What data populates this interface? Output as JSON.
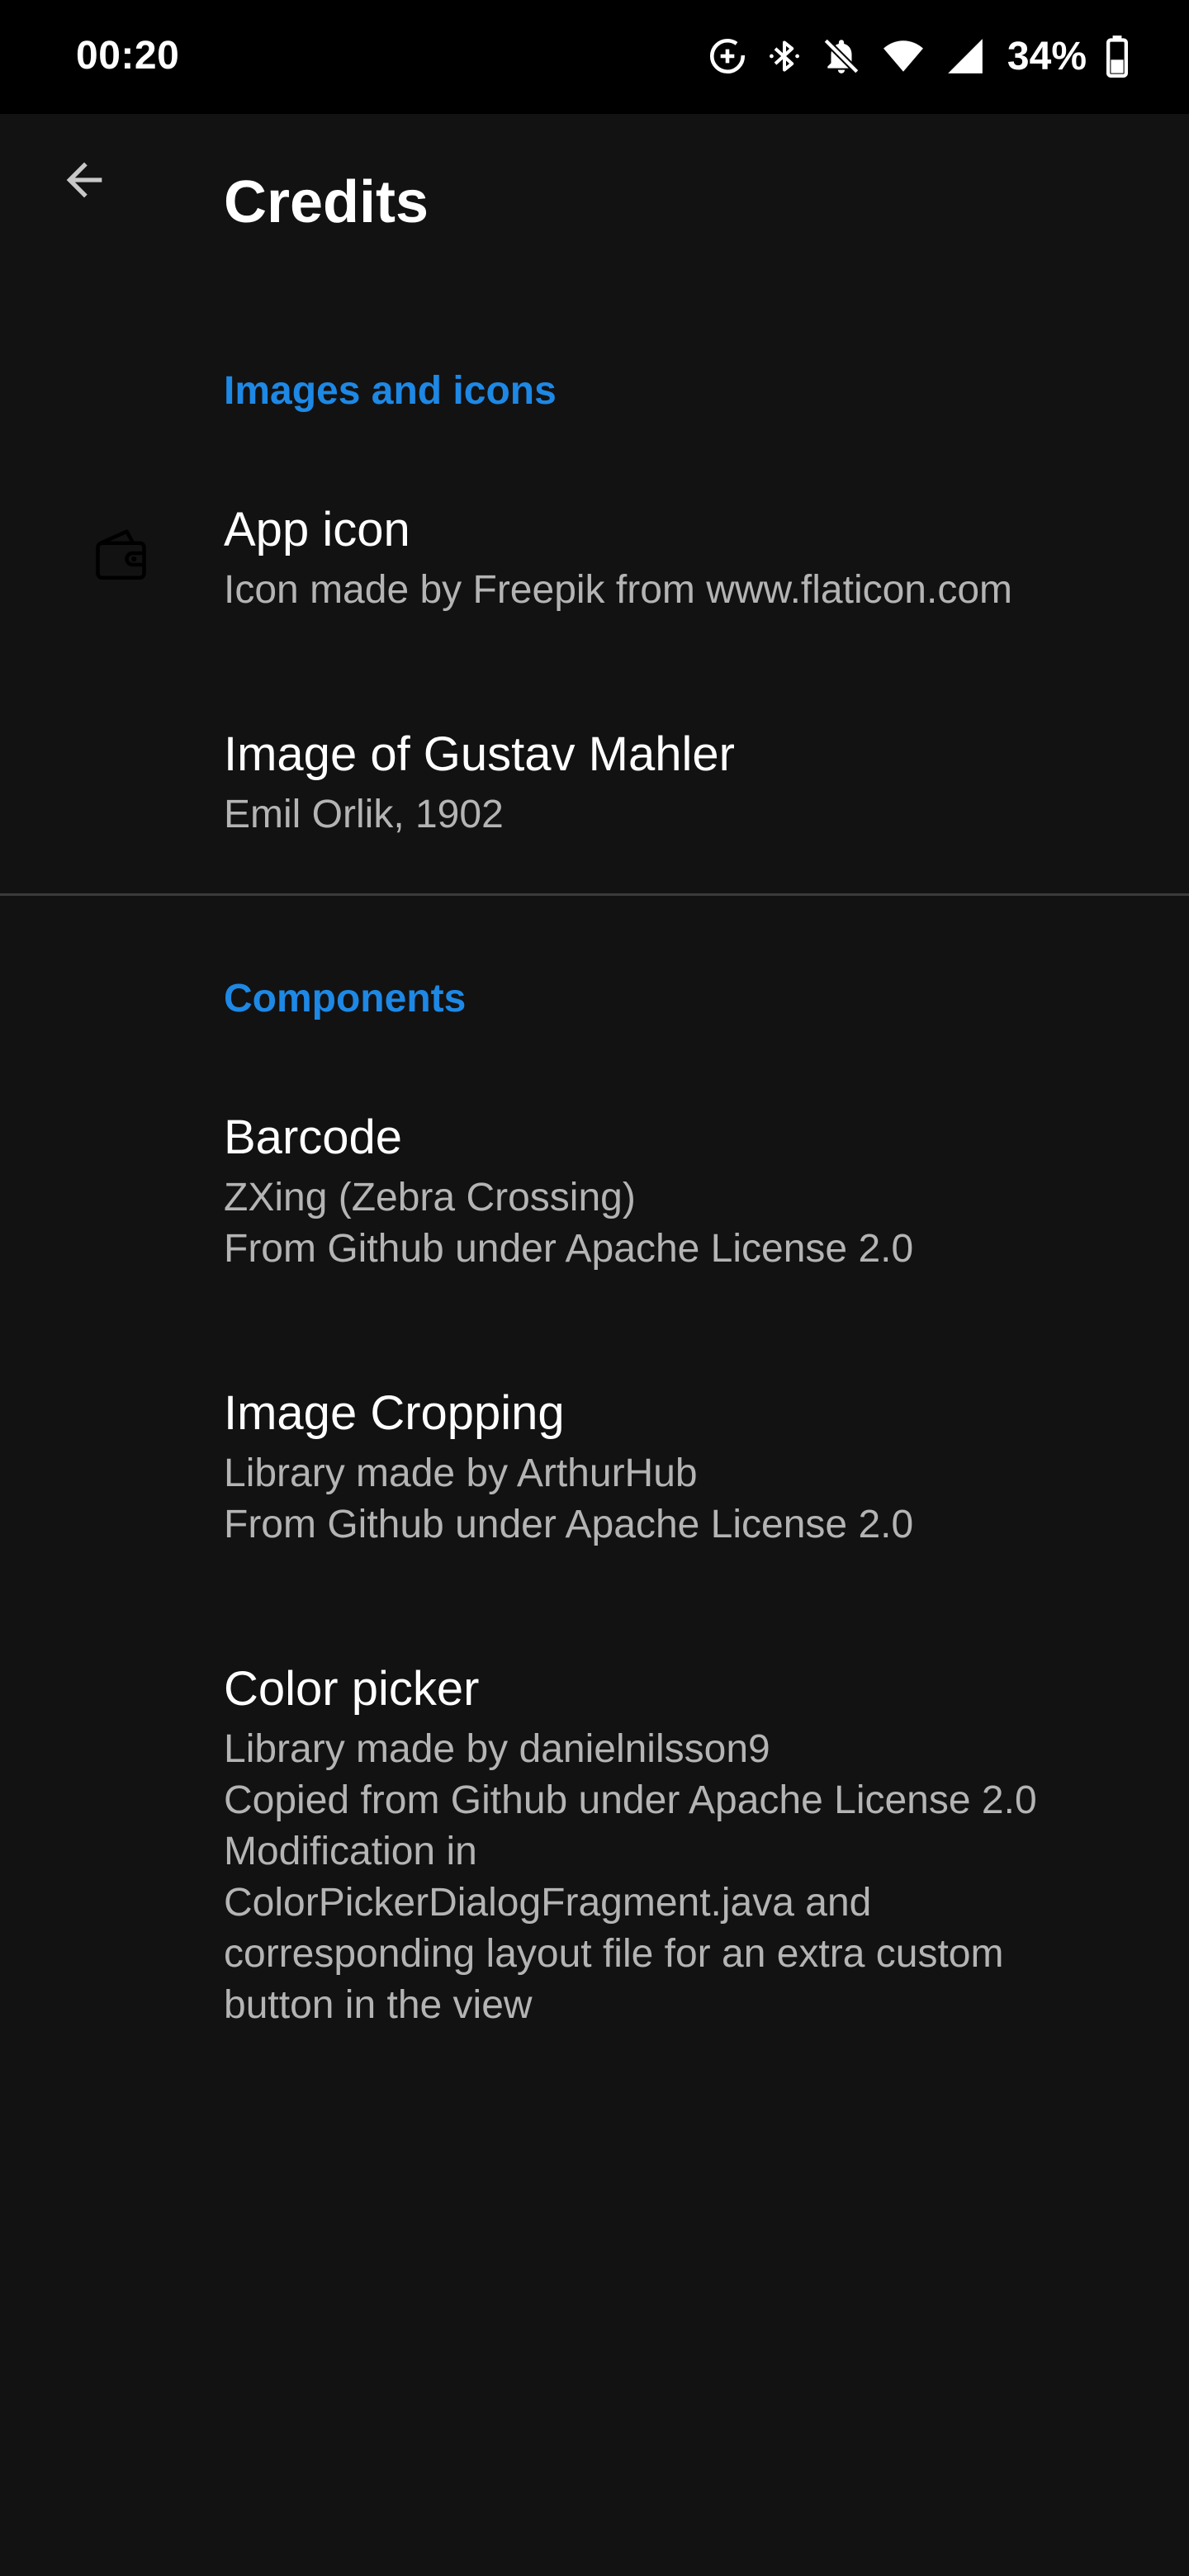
{
  "status_bar": {
    "time": "00:20",
    "battery_percent": "34%",
    "icons": [
      "data-saver-icon",
      "bluetooth-icon",
      "notifications-off-icon",
      "wifi-icon",
      "signal-icon",
      "battery-icon"
    ]
  },
  "app_bar": {
    "title": "Credits",
    "back_icon": "arrow-back-icon"
  },
  "sections": {
    "images": {
      "header": "Images and icons",
      "items": [
        {
          "title": "App icon",
          "summary": [
            "Icon made by Freepik from www.flaticon.com"
          ],
          "icon": "wallet-icon"
        },
        {
          "title": "Image of Gustav Mahler",
          "summary": [
            "Emil Orlik, 1902"
          ]
        }
      ]
    },
    "components": {
      "header": "Components",
      "items": [
        {
          "title": "Barcode",
          "summary": [
            "ZXing (Zebra Crossing)",
            "From Github under Apache License 2.0"
          ]
        },
        {
          "title": "Image Cropping",
          "summary": [
            "Library made by ArthurHub",
            "From Github under Apache License 2.0"
          ]
        },
        {
          "title": "Color picker",
          "summary": [
            "Library made by danielnilsson9",
            "Copied from Github under Apache License 2.0",
            "Modification in",
            "ColorPickerDialogFragment.java and",
            "corresponding layout file for an extra custom",
            "button in the view"
          ]
        }
      ]
    }
  },
  "colors": {
    "background": "#121212",
    "status_bar": "#000000",
    "accent": "#1e88e5",
    "title_text": "#ffffff",
    "summary_text": "#b4b4b4",
    "divider": "#3a3a3a"
  }
}
